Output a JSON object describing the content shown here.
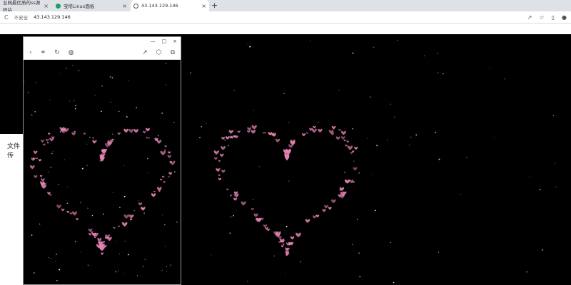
{
  "tabs": [
    {
      "label": "业网最优质的ss源码站"
    },
    {
      "label": "宝塔Linux面板"
    },
    {
      "label": "43.143.129.146"
    }
  ],
  "address": {
    "warning": "不安全",
    "url": "43.143.129.146"
  },
  "side_label": "文件传",
  "colors": {
    "heart": "#e583b4",
    "background": "#000000"
  }
}
